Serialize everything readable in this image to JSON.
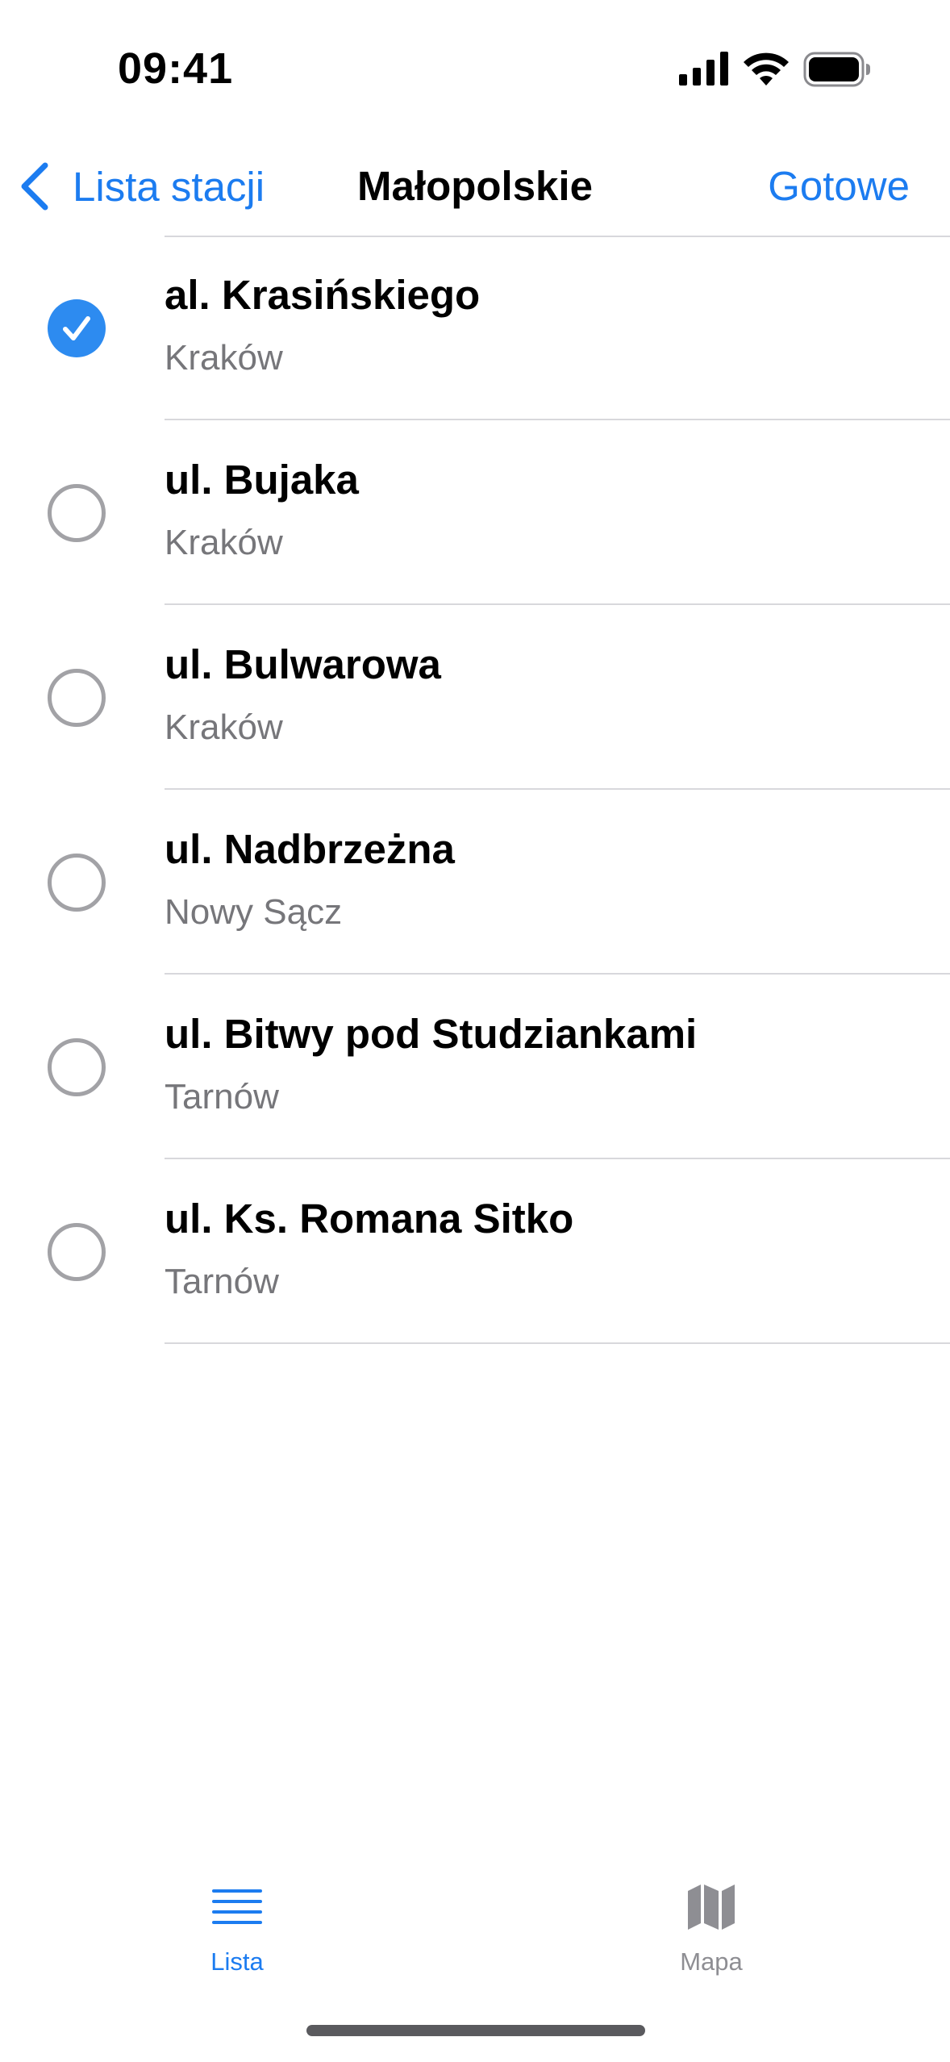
{
  "status_bar": {
    "time": "09:41"
  },
  "nav": {
    "back_label": "Lista stacji",
    "title": "Małopolskie",
    "done_label": "Gotowe"
  },
  "stations": [
    {
      "name": "al. Krasińskiego",
      "city": "Kraków",
      "selected": true
    },
    {
      "name": "ul. Bujaka",
      "city": "Kraków",
      "selected": false
    },
    {
      "name": "ul. Bulwarowa",
      "city": "Kraków",
      "selected": false
    },
    {
      "name": "ul. Nadbrzeżna",
      "city": "Nowy Sącz",
      "selected": false
    },
    {
      "name": "ul. Bitwy pod Studziankami",
      "city": "Tarnów",
      "selected": false
    },
    {
      "name": "ul. Ks. Romana Sitko",
      "city": "Tarnów",
      "selected": false
    }
  ],
  "tab_bar": {
    "tabs": [
      {
        "label": "Lista",
        "icon": "list-icon",
        "active": true
      },
      {
        "label": "Mapa",
        "icon": "map-icon",
        "active": false
      }
    ]
  },
  "colors": {
    "accent": "#1c7cf0",
    "checked": "#2d8bf0",
    "secondary_text": "#76767a",
    "separator": "#d8d8dc"
  }
}
